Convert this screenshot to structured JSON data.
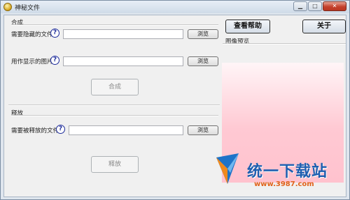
{
  "window": {
    "title": "神秘文件",
    "controls": {
      "minimize": "▁",
      "maximize": "□",
      "close": "✕"
    }
  },
  "combine": {
    "group_title": "合成",
    "hide_file_label": "需要隐藏的文件",
    "hide_file_value": "",
    "image_label": "用作显示的图片",
    "image_value": "",
    "browse_label": "浏览",
    "action_label": "合成"
  },
  "release": {
    "group_title": "释放",
    "file_label": "需要被释放的文件",
    "file_value": "",
    "browse_label": "浏览",
    "action_label": "释放"
  },
  "help": {
    "glyph": "?"
  },
  "side": {
    "help_button": "查看帮助",
    "about_button": "关于",
    "preview_title": "图像预览"
  },
  "watermark": {
    "text": "统一下载站",
    "url": "www.3987.com",
    "colors": {
      "text": "#1e5fb0",
      "url": "#e0621a"
    }
  },
  "colors": {
    "preview_pink": "#ffc2ce",
    "help_icon": "#1d2b9a"
  }
}
